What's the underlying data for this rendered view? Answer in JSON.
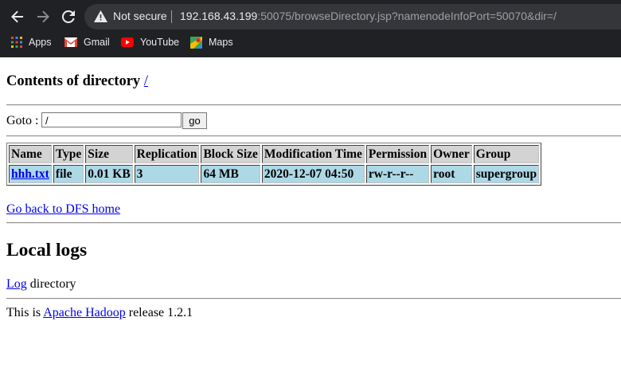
{
  "browser": {
    "security_label": "Not secure",
    "url_host": "192.168.43.199",
    "url_rest": ":50075/browseDirectory.jsp?namenodeInfoPort=50070&dir=/",
    "bookmarks": [
      {
        "label": "Apps",
        "icon": "apps-grid-icon"
      },
      {
        "label": "Gmail",
        "icon": "gmail-icon"
      },
      {
        "label": "YouTube",
        "icon": "youtube-icon"
      },
      {
        "label": "Maps",
        "icon": "maps-icon"
      }
    ]
  },
  "page": {
    "heading_prefix": "Contents of directory",
    "heading_link": "/",
    "goto_label": "Goto :",
    "goto_value": "/",
    "go_button": "go",
    "table": {
      "headers": [
        "Name",
        "Type",
        "Size",
        "Replication",
        "Block Size",
        "Modification Time",
        "Permission",
        "Owner",
        "Group"
      ],
      "rows": [
        [
          "hhh.txt",
          "file",
          "0.01 KB",
          "3",
          "64 MB",
          "2020-12-07 04:50",
          "rw-r--r--",
          "root",
          "supergroup"
        ]
      ]
    },
    "back_link": "Go back to DFS home",
    "local_logs_heading": "Local logs",
    "log_link": "Log",
    "log_suffix": " directory",
    "footer_prefix": "This is ",
    "footer_link": "Apache Hadoop",
    "footer_suffix": " release 1.2.1"
  },
  "colors": {
    "chrome_bg": "#202124",
    "omnibox_bg": "#35363a",
    "table_header_bg": "#d3d3d3",
    "table_row_bg": "#add8e6",
    "link": "#0000ee"
  }
}
